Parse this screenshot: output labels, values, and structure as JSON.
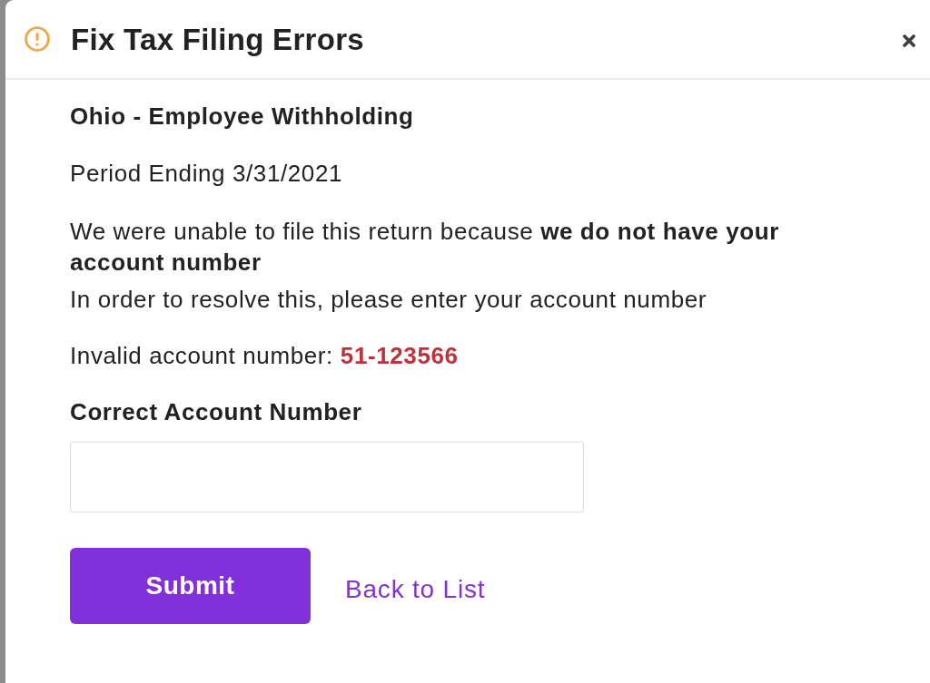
{
  "dialog": {
    "title": "Fix Tax Filing Errors",
    "heading": "Ohio - Employee Withholding",
    "period": "Period Ending 3/31/2021",
    "message": "We were unable to file this return because **we do not have your account number**",
    "instruction": "In order to resolve this, please enter your account number",
    "invalid_account": {
      "label": "Invalid account number:",
      "value": "51-123566"
    },
    "field": {
      "label": "Correct Account Number"
    },
    "submit_button": "Submit",
    "back_link": "Back to List"
  }
}
